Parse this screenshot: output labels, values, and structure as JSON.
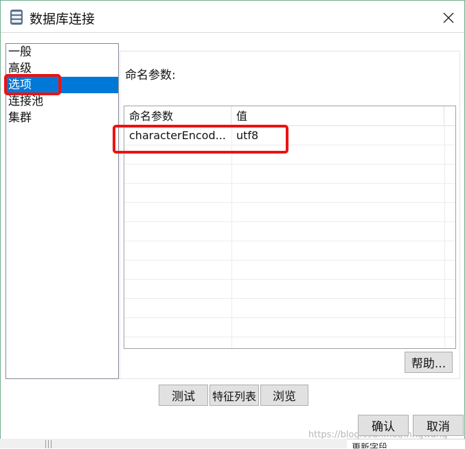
{
  "window": {
    "title": "数据库连接",
    "icon": "database-icon"
  },
  "nav": {
    "items": [
      {
        "label": "一般"
      },
      {
        "label": "高级"
      },
      {
        "label": "选项"
      },
      {
        "label": "连接池"
      },
      {
        "label": "集群"
      }
    ],
    "selected": "选项"
  },
  "panel": {
    "label": "命名参数:",
    "grid": {
      "headers": [
        "命名参数",
        "值"
      ],
      "rows": [
        {
          "name": "characterEncod...",
          "value": "utf8"
        }
      ]
    },
    "help_button": "帮助..."
  },
  "actions": {
    "test": "测试",
    "features": "特征列表",
    "browse": "浏览",
    "ok": "确认",
    "cancel": "取消"
  },
  "watermark": "https://blog.csdn.net/lnngwang",
  "peek_text": "更新字段",
  "colors": {
    "selection": "#0078d7",
    "highlight": "#ee1111"
  }
}
